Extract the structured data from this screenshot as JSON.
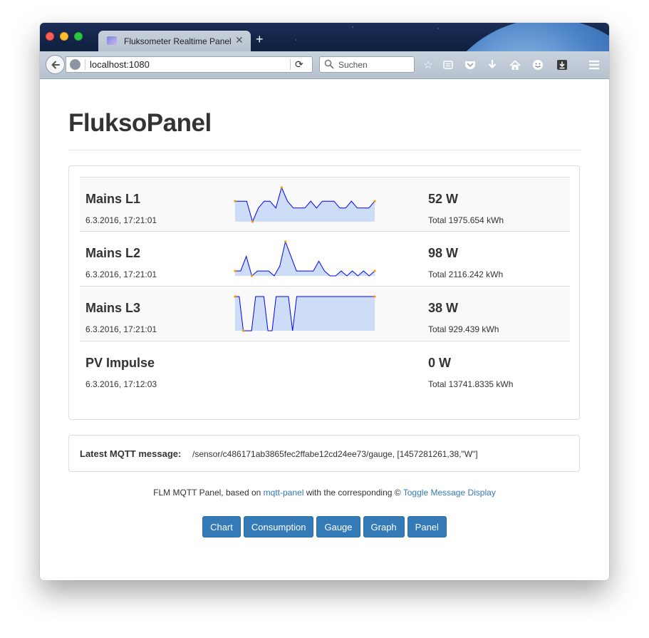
{
  "browser": {
    "tab_title": "Fluksometer Realtime Panel",
    "url": "localhost:1080",
    "search_placeholder": "Suchen"
  },
  "page": {
    "title": "FluksoPanel"
  },
  "sensors": [
    {
      "name": "Mains L1",
      "timestamp": "6.3.2016, 17:21:01",
      "power": "52 W",
      "total": "Total 1975.654 kWh",
      "sparkline": [
        3,
        3,
        3,
        0,
        2,
        3,
        3,
        2,
        5,
        3,
        2,
        2,
        2,
        3,
        2,
        3,
        3,
        3,
        2,
        2,
        3,
        2,
        2,
        2,
        3
      ]
    },
    {
      "name": "Mains L2",
      "timestamp": "6.3.2016, 17:21:01",
      "power": "98 W",
      "total": "Total 2116.242 kWh",
      "sparkline": [
        1,
        1,
        4,
        0,
        1,
        1,
        1,
        0,
        2,
        7,
        4,
        1,
        1,
        1,
        1,
        3,
        1,
        0,
        0,
        1,
        0,
        1,
        0,
        1,
        0,
        1
      ]
    },
    {
      "name": "Mains L3",
      "timestamp": "6.3.2016, 17:21:01",
      "power": "38 W",
      "total": "Total 929.439 kWh",
      "sparkline": [
        1,
        1,
        0,
        0,
        0,
        1,
        1,
        1,
        0,
        0,
        1,
        1,
        1,
        1,
        0,
        1,
        1,
        1,
        1,
        1,
        1,
        1,
        1,
        1,
        1,
        1,
        1,
        1,
        1,
        1,
        1,
        1,
        1,
        1,
        1
      ]
    },
    {
      "name": "PV Impulse",
      "timestamp": "6.3.2016, 17:12:03",
      "power": "0 W",
      "total": "Total 13741.8335 kWh",
      "sparkline": []
    }
  ],
  "mqtt": {
    "label": "Latest MQTT message:",
    "message": "/sensor/c486171ab3865fec2ffabe12cd24ee73/gauge, [1457281261,38,\"W\"]"
  },
  "footer": {
    "prefix": "FLM MQTT Panel, based on ",
    "link1": "mqtt-panel",
    "middle": " with the corresponding © ",
    "link2": "Toggle Message Display"
  },
  "nav_buttons": [
    "Chart",
    "Consumption",
    "Gauge",
    "Graph",
    "Panel"
  ],
  "colors": {
    "accent": "#337ab7",
    "sparkline_line": "#0000ff",
    "sparkline_fill": "#cdddf7",
    "sparkline_marker": "#ff9900"
  }
}
